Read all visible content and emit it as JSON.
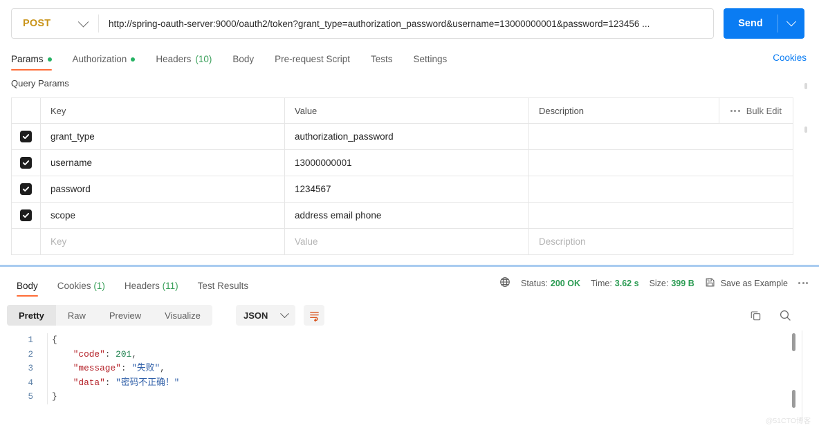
{
  "request": {
    "method": "POST",
    "url": "http://spring-oauth-server:9000/oauth2/token?grant_type=authorization_password&username=13000000001&password=123456 ...",
    "send_label": "Send",
    "cookies_link": "Cookies",
    "tabs": [
      {
        "label": "Params",
        "dot": true
      },
      {
        "label": "Authorization",
        "dot": true
      },
      {
        "label": "Headers",
        "count": "(10)"
      },
      {
        "label": "Body"
      },
      {
        "label": "Pre-request Script"
      },
      {
        "label": "Tests"
      },
      {
        "label": "Settings"
      }
    ],
    "params": {
      "section_title": "Query Params",
      "headers": {
        "key": "Key",
        "value": "Value",
        "description": "Description"
      },
      "bulk_edit_label": "Bulk Edit",
      "rows": [
        {
          "checked": true,
          "key": "grant_type",
          "value": "authorization_password",
          "description": ""
        },
        {
          "checked": true,
          "key": "username",
          "value": "13000000001",
          "description": ""
        },
        {
          "checked": true,
          "key": "password",
          "value": "1234567",
          "description": ""
        },
        {
          "checked": true,
          "key": "scope",
          "value": "address email phone",
          "description": ""
        }
      ],
      "empty_row": {
        "key_placeholder": "Key",
        "value_placeholder": "Value",
        "description_placeholder": "Description"
      }
    }
  },
  "response": {
    "tabs": [
      {
        "label": "Body"
      },
      {
        "label": "Cookies",
        "count": "(1)"
      },
      {
        "label": "Headers",
        "count": "(11)"
      },
      {
        "label": "Test Results"
      }
    ],
    "meta": {
      "status_label": "Status:",
      "status_value": "200 OK",
      "time_label": "Time:",
      "time_value": "3.62 s",
      "size_label": "Size:",
      "size_value": "399 B",
      "save_as_example": "Save as Example"
    },
    "format_tabs": [
      "Pretty",
      "Raw",
      "Preview",
      "Visualize"
    ],
    "format_active": "Pretty",
    "language": "JSON",
    "body": {
      "line_numbers": [
        "1",
        "2",
        "3",
        "4",
        "5"
      ],
      "lines": [
        {
          "text": "{",
          "type": "punct"
        },
        {
          "key": "\"code\"",
          "sep": ": ",
          "val": "201",
          "val_type": "num",
          "tail": ","
        },
        {
          "key": "\"message\"",
          "sep": ": ",
          "val": "\"失败\"",
          "val_type": "str",
          "tail": ","
        },
        {
          "key": "\"data\"",
          "sep": ": ",
          "val": "\"密码不正确！\"",
          "val_type": "str",
          "tail": ""
        },
        {
          "text": "}",
          "type": "punct"
        }
      ]
    }
  },
  "watermark": "@51CTO博客",
  "colors": {
    "accent_orange": "#ff6c37",
    "send_blue": "#0a7cf3",
    "method_gold": "#c9941a",
    "status_green": "#2a9b52"
  }
}
